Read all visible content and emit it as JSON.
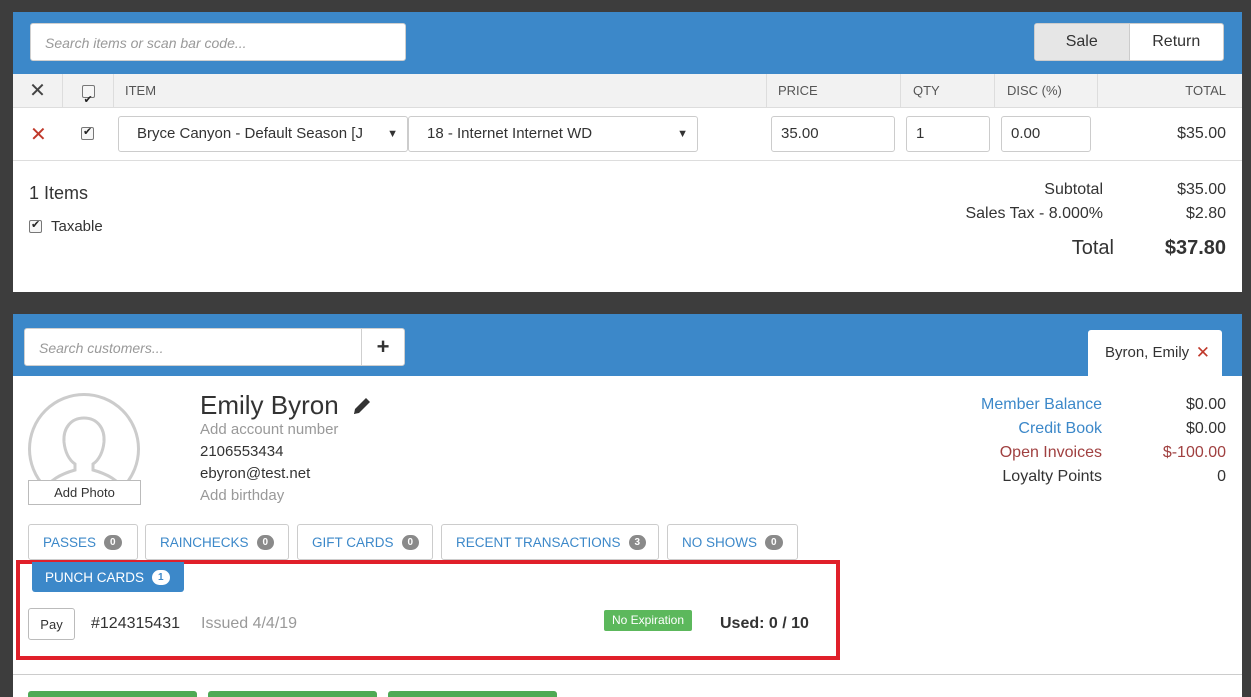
{
  "sale": {
    "search_placeholder": "Search items or scan bar code...",
    "modes": [
      "Sale",
      "Return"
    ],
    "columns": {
      "item": "ITEM",
      "price": "PRICE",
      "qty": "QTY",
      "disc": "DISC (%)",
      "total": "TOTAL"
    },
    "row": {
      "item_select": "Bryce Canyon - Default Season [J",
      "rate_select": "18 - Internet Internet WD",
      "price": "35.00",
      "qty": "1",
      "disc": "0.00",
      "total": "$35.00"
    },
    "summary": {
      "items_count": "1 Items",
      "taxable_label": "Taxable",
      "subtotal_label": "Subtotal",
      "subtotal_value": "$35.00",
      "tax_label": "Sales Tax - 8.000%",
      "tax_value": "$2.80",
      "total_label": "Total",
      "total_value": "$37.80"
    }
  },
  "customer": {
    "search_placeholder": "Search customers...",
    "add_glyph": "+",
    "tab_name": "Byron, Emily",
    "tab_close_glyph": "✕",
    "name": "Emily Byron",
    "account": "Add account number",
    "phone": "2106553434",
    "email": "ebyron@test.net",
    "birthday": "Add birthday",
    "add_photo": "Add Photo",
    "balances": [
      {
        "label": "Member Balance",
        "value": "$0.00"
      },
      {
        "label": "Credit Book",
        "value": "$0.00"
      },
      {
        "label": "Open Invoices",
        "value": "$-100.00"
      },
      {
        "label": "Loyalty Points",
        "value": "0"
      }
    ],
    "tabs": [
      {
        "label": "PASSES",
        "count": "0"
      },
      {
        "label": "RAINCHECKS",
        "count": "0"
      },
      {
        "label": "GIFT CARDS",
        "count": "0"
      },
      {
        "label": "RECENT TRANSACTIONS",
        "count": "3"
      },
      {
        "label": "NO SHOWS",
        "count": "0"
      }
    ],
    "punch": {
      "tab_label": "PUNCH CARDS",
      "tab_count": "1",
      "pay_label": "Pay",
      "number": "#124315431",
      "issued": "Issued 4/4/19",
      "expiration": "No Expiration",
      "used": "Used: 0 / 10"
    }
  },
  "colors": {
    "header_blue": "#3c88c9",
    "highlight_red": "#e0202a",
    "badge_green": "#5cb85c",
    "remove_red": "#c0392b"
  },
  "icons": {
    "remove": "close-icon",
    "checkbox": "checkbox-icon",
    "caret": "caret-down-icon",
    "edit": "pencil-icon",
    "avatar": "user-silhouette-icon"
  }
}
